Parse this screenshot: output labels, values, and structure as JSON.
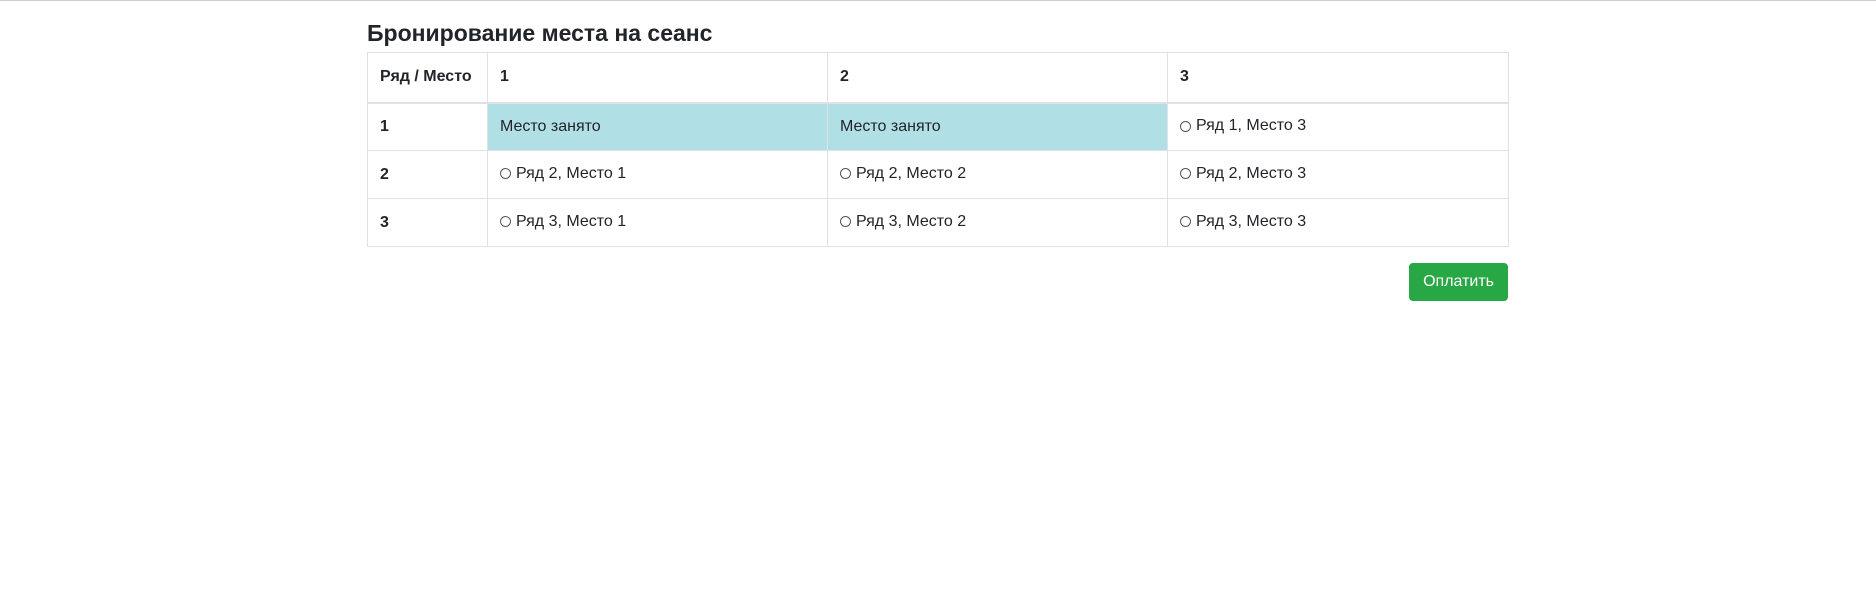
{
  "page": {
    "title": "Бронирование места на сеанс"
  },
  "table": {
    "corner_header": "Ряд / Место",
    "columns": [
      "1",
      "2",
      "3"
    ],
    "rows": [
      {
        "label": "1",
        "cells": [
          {
            "text": "Место занято",
            "taken": true
          },
          {
            "text": "Место занято",
            "taken": true
          },
          {
            "text": "Ряд 1, Место 3",
            "taken": false
          }
        ]
      },
      {
        "label": "2",
        "cells": [
          {
            "text": "Ряд 2, Место 1",
            "taken": false
          },
          {
            "text": "Ряд 2, Место 2",
            "taken": false
          },
          {
            "text": "Ряд 2, Место 3",
            "taken": false
          }
        ]
      },
      {
        "label": "3",
        "cells": [
          {
            "text": "Ряд 3, Место 1",
            "taken": false
          },
          {
            "text": "Ряд 3, Место 2",
            "taken": false
          },
          {
            "text": "Ряд 3, Место 3",
            "taken": false
          }
        ]
      }
    ]
  },
  "actions": {
    "pay_label": "Оплатить"
  },
  "colors": {
    "taken_bg": "#b0dfe5",
    "pay_button": "#28a745",
    "border": "#dee2e6"
  }
}
